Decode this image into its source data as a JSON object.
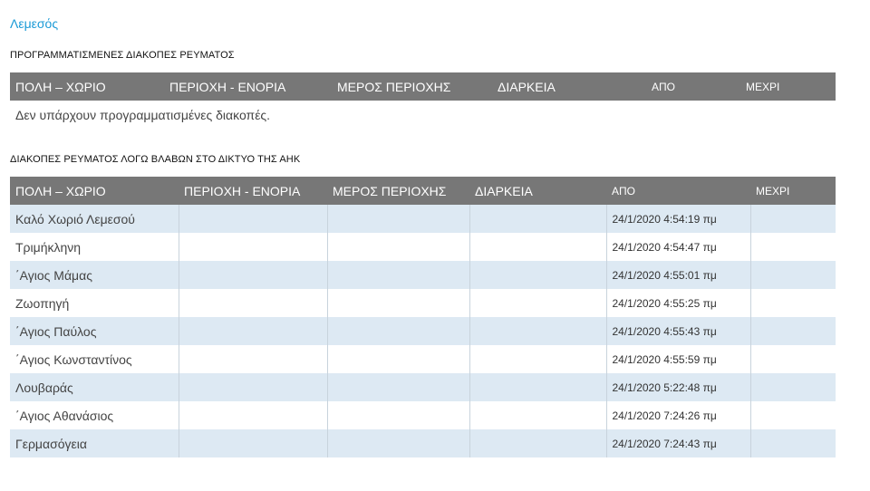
{
  "region": "Λεμεσός",
  "planned": {
    "title": "ΠΡΟΓΡΑΜΜΑΤΙΣΜΕΝΕΣ ΔΙΑΚΟΠΕΣ ΡΕΥΜΑΤΟΣ",
    "columns": [
      "ΠΟΛΗ – ΧΩΡΙΟ",
      "ΠΕΡΙΟΧΗ - ΕΝΟΡΙΑ",
      "ΜΕΡΟΣ ΠΕΡΙΟΧΗΣ",
      "ΔΙΑΡΚΕΙΑ",
      "ΑΠΟ",
      "ΜΕΧΡΙ"
    ],
    "empty_message": "Δεν υπάρχουν προγραμματισμένες διακοπές."
  },
  "faults": {
    "title": "ΔΙΑΚΟΠΕΣ ΡΕΥΜΑΤΟΣ ΛΟΓΩ ΒΛΑΒΩΝ ΣΤΟ ΔΙΚΤΥΟ ΤΗΣ ΑΗΚ",
    "columns": [
      "ΠΟΛΗ – ΧΩΡΙΟ",
      "ΠΕΡΙΟΧΗ - ΕΝΟΡΙΑ",
      "ΜΕΡΟΣ ΠΕΡΙΟΧΗΣ",
      "ΔΙΑΡΚΕΙΑ",
      "ΑΠΟ",
      "ΜΕΧΡΙ"
    ],
    "rows": [
      {
        "town": "Καλό Χωριό Λεμεσού",
        "area": "",
        "part": "",
        "duration": "",
        "from": "24/1/2020 4:54:19 πμ",
        "to": ""
      },
      {
        "town": "Τριμήκληνη",
        "area": "",
        "part": "",
        "duration": "",
        "from": "24/1/2020 4:54:47 πμ",
        "to": ""
      },
      {
        "town": "΄Αγιος Μάμας",
        "area": "",
        "part": "",
        "duration": "",
        "from": "24/1/2020 4:55:01 πμ",
        "to": ""
      },
      {
        "town": "Ζωοπηγή",
        "area": "",
        "part": "",
        "duration": "",
        "from": "24/1/2020 4:55:25 πμ",
        "to": ""
      },
      {
        "town": "΄Αγιος Παύλος",
        "area": "",
        "part": "",
        "duration": "",
        "from": "24/1/2020 4:55:43 πμ",
        "to": ""
      },
      {
        "town": "΄Αγιος Κωνσταντίνος",
        "area": "",
        "part": "",
        "duration": "",
        "from": "24/1/2020 4:55:59 πμ",
        "to": ""
      },
      {
        "town": "Λουβαράς",
        "area": "",
        "part": "",
        "duration": "",
        "from": "24/1/2020 5:22:48 πμ",
        "to": ""
      },
      {
        "town": "΄Αγιος Αθανάσιος",
        "area": "",
        "part": "",
        "duration": "",
        "from": "24/1/2020 7:24:26 πμ",
        "to": ""
      },
      {
        "town": "Γερμασόγεια",
        "area": "",
        "part": "",
        "duration": "",
        "from": "24/1/2020 7:24:43 πμ",
        "to": ""
      }
    ]
  },
  "colors": {
    "region_title": "#1a9ad6",
    "header_bg": "#777777",
    "row_alt_bg": "#dde9f3"
  }
}
